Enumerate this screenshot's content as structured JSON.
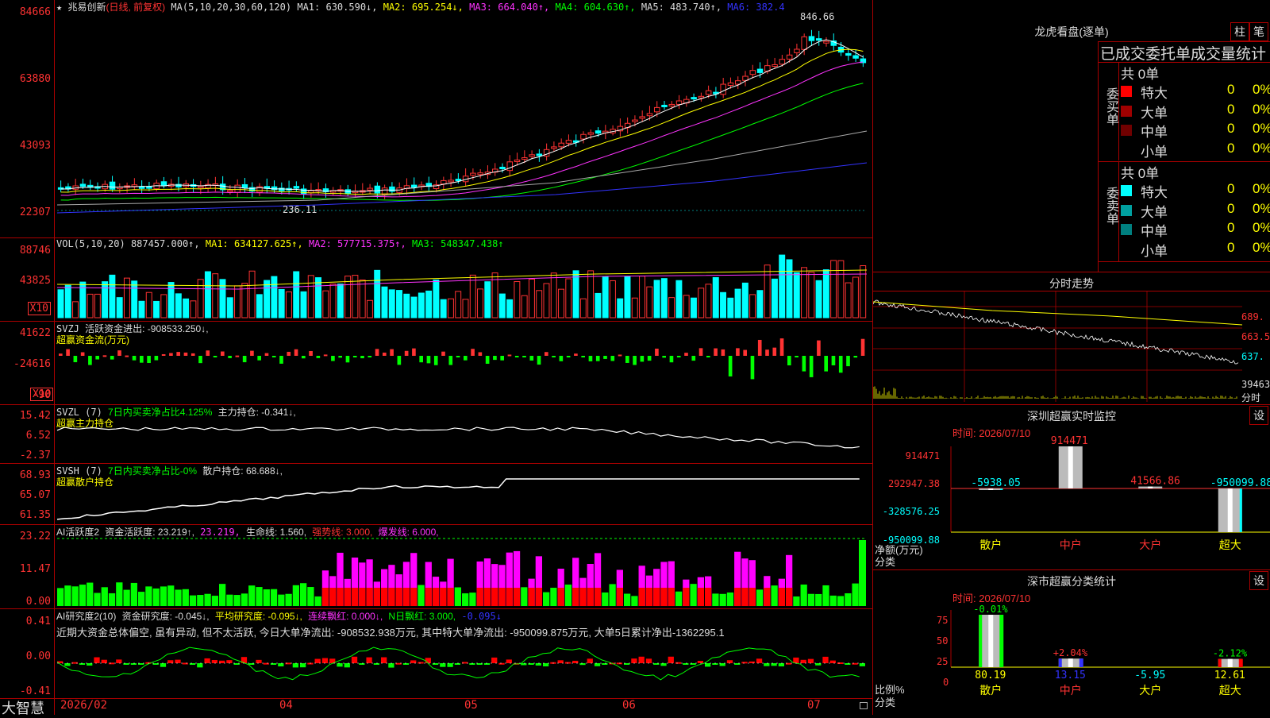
{
  "app": {
    "logo": "大智慧"
  },
  "kline": {
    "star": "★",
    "name": "兆易创新",
    "mode": "(日线, 前复权)",
    "ma_params": "MA(5,10,20,30,60,120)",
    "ma1": "MA1: 630.590↓,",
    "ma2": "MA2: 695.254↓,",
    "ma3": "MA3: 664.040↑,",
    "ma4": "MA4: 604.630↑,",
    "ma5": "MA5: 483.740↑,",
    "ma6": "MA6: 382.4",
    "high_label": "846.66",
    "low_label": "236.11",
    "yticks": [
      "84666",
      "63880",
      "43093",
      "22307"
    ]
  },
  "vol": {
    "params": "VOL(5,10,20)",
    "value": "887457.000↑,",
    "ma1": "MA1: 634127.625↑,",
    "ma2": "MA2: 577715.375↑,",
    "ma3": "MA3: 548347.438↑",
    "yticks": [
      "88746",
      "43825"
    ],
    "unit": "X10"
  },
  "svzj": {
    "title": "SVZJ",
    "label": "活跃资金进出: -908533.250↓,",
    "sub": "超赢资金流(万元)",
    "yticks": [
      "41622",
      "-24616",
      "-90"
    ],
    "unit": "X10"
  },
  "svzl": {
    "title": "SVZL (7)",
    "label1": "7日内买卖净占比4.125%",
    "label2": "主力持仓: -0.341↓,",
    "sub": "超赢主力持仓",
    "yticks": [
      "15.42",
      "6.52",
      "-2.37"
    ]
  },
  "svsh": {
    "title": "SVSH (7)",
    "label1": "7日内买卖净占比-0%",
    "label2": "散户持仓: 68.688↓,",
    "sub": "超赢散户持仓",
    "yticks": [
      "68.93",
      "65.07",
      "61.35"
    ]
  },
  "ai1": {
    "title": "AI活跃度2",
    "l1": "资金活跃度: 23.219↑,",
    "l2": "23.219,",
    "l3": "生命线: 1.560,",
    "l4": "强势线: 3.000,",
    "l5": "爆发线: 6.000,",
    "yticks": [
      "23.22",
      "11.47",
      "0.00"
    ]
  },
  "ai2": {
    "title": "AI研究度2(10)",
    "l1": "资金研究度: -0.045↓,",
    "l2": "平均研究度: -0.095↓,",
    "l3": "连续飘红: 0.000↓,",
    "l4": "N日飘红: 3.000,",
    "l5": "-0.095↓",
    "note": "近期大资金总体偏空, 虽有异动, 但不太活跃, 今日大单净流出: -908532.938万元, 其中特大单净流出: -950099.875万元, 大单5日累计净出-1362295.1",
    "yticks": [
      "0.41",
      "0.00",
      "-0.41"
    ]
  },
  "xaxis": {
    "labels": [
      "2026/02",
      "04",
      "05",
      "06",
      "07"
    ]
  },
  "lhb": {
    "title": "龙虎看盘(逐单)",
    "btn1": "柱",
    "btn2": "笔",
    "header": "已成交委托单成交量统计",
    "buy_label": "委买单",
    "sell_label": "委卖单",
    "buy_total": "共 0单",
    "sell_total": "共 0单",
    "buy_rows": [
      {
        "name": "特大",
        "count": "0",
        "pct": "0%",
        "color": "#ff0000"
      },
      {
        "name": "大单",
        "count": "0",
        "pct": "0%",
        "color": "#a00000"
      },
      {
        "name": "中单",
        "count": "0",
        "pct": "0%",
        "color": "#700000"
      },
      {
        "name": "小单",
        "count": "0",
        "pct": "0%",
        "color": ""
      }
    ],
    "sell_rows": [
      {
        "name": "特大",
        "count": "0",
        "pct": "0%",
        "color": "#00ffff"
      },
      {
        "name": "大单",
        "count": "0",
        "pct": "0%",
        "color": "#00a0a0"
      },
      {
        "name": "中单",
        "count": "0",
        "pct": "0%",
        "color": "#008080"
      },
      {
        "name": "小单",
        "count": "0",
        "pct": "0%",
        "color": ""
      }
    ]
  },
  "fenshi": {
    "title": "分时走势",
    "yticks": [
      "689.",
      "663.5",
      "637.",
      "39463"
    ],
    "unit": "分时"
  },
  "monitor": {
    "title": "深圳超赢实时监控",
    "btn": "设",
    "time": "时间: 2026/07/10",
    "yticks": [
      "914471",
      "292947.38",
      "-328576.25",
      "-950099.88"
    ],
    "ylabel1": "净额(万元)",
    "ylabel2": "分类",
    "bars": [
      {
        "cat": "散户",
        "value": -5938.05,
        "label": "-5938.05",
        "label_color": "#0ff",
        "cat_color": "#ff0"
      },
      {
        "cat": "中户",
        "value": 914471,
        "label": "914471",
        "label_color": "#f33",
        "cat_color": "#f33"
      },
      {
        "cat": "大户",
        "value": 41566.86,
        "label": "41566.86",
        "label_color": "#f33",
        "cat_color": "#f33"
      },
      {
        "cat": "超大",
        "value": -950099.88,
        "label": "-950099.88",
        "label_color": "#0ff",
        "cat_color": "#ff0"
      }
    ]
  },
  "classify": {
    "title": "深市超赢分类统计",
    "btn": "设",
    "time": "时间: 2026/07/10",
    "yticks": [
      "75",
      "50",
      "25",
      "0"
    ],
    "ylabel1": "比例%",
    "ylabel2": "分类",
    "bars": [
      {
        "cat": "散户",
        "value": 80.19,
        "label": "80.19",
        "delta": "-0.01%",
        "delta_color": "#0f0",
        "cat_color": "#ff0",
        "val_color": "#ff0"
      },
      {
        "cat": "中户",
        "value": 13.15,
        "label": "13.15",
        "delta": "+2.04%",
        "delta_color": "#f33",
        "cat_color": "#f33",
        "val_color": "#33f"
      },
      {
        "cat": "大户",
        "value": -5.95,
        "label": "-5.95",
        "delta": "",
        "delta_color": "#f33",
        "cat_color": "#ff0",
        "val_color": "#0ff"
      },
      {
        "cat": "超大",
        "value": 12.61,
        "label": "12.61",
        "delta": "-2.12%",
        "delta_color": "#0f0",
        "cat_color": "#ff0",
        "val_color": "#ff0"
      }
    ]
  }
}
